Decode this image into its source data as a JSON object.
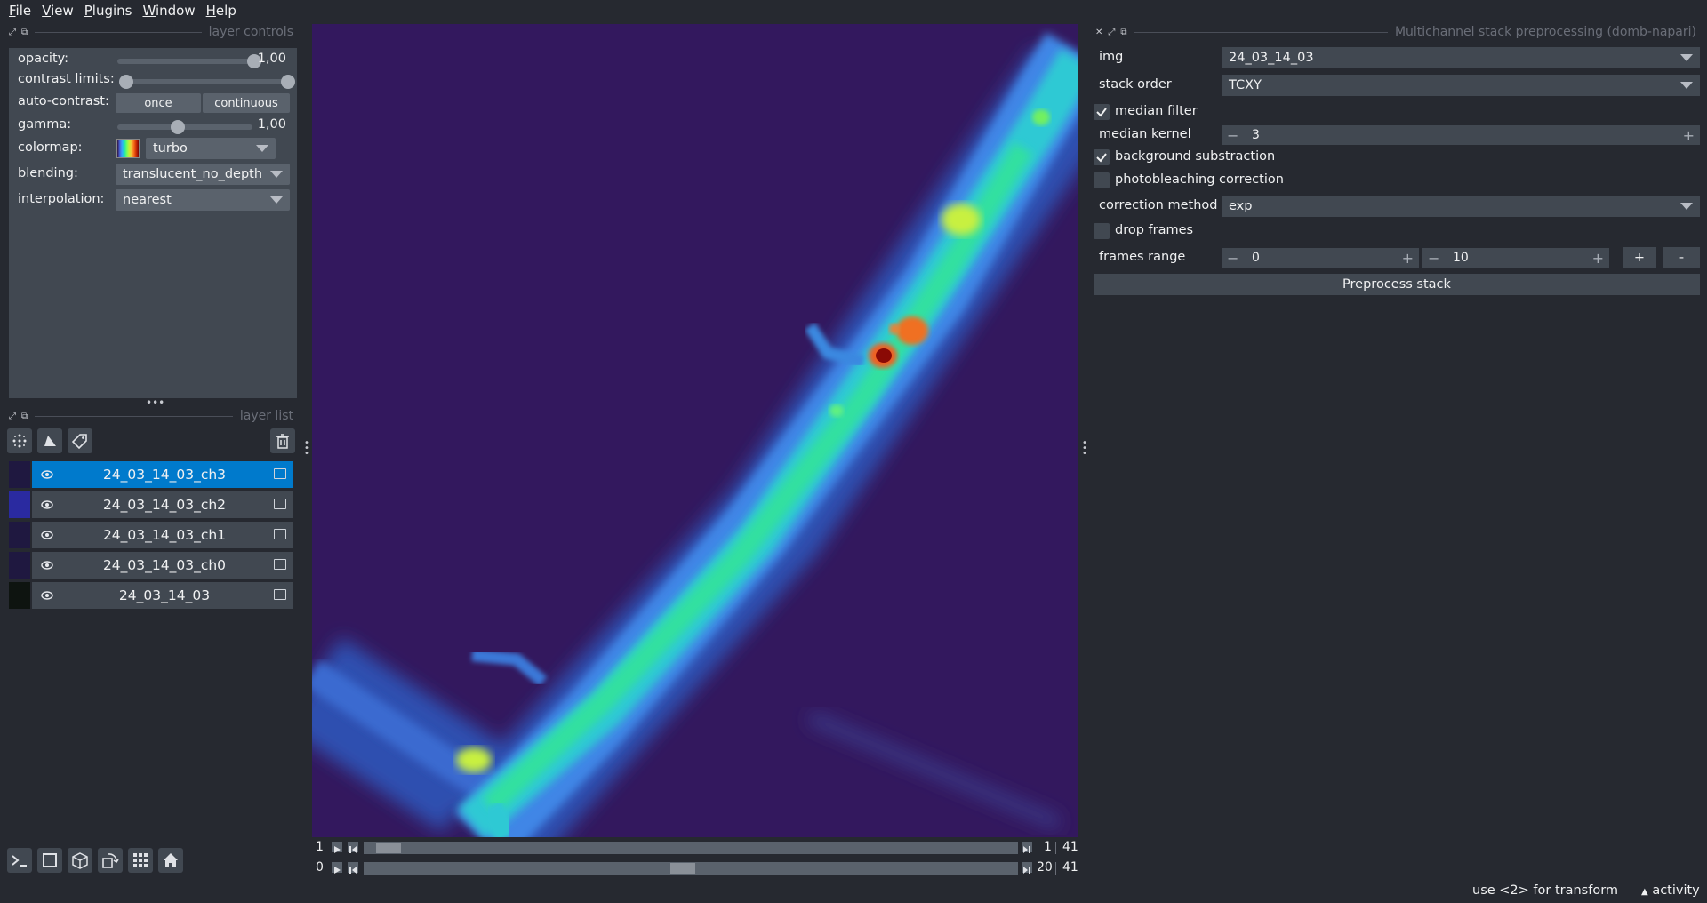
{
  "menubar": {
    "items": [
      {
        "first": "F",
        "rest": "ile"
      },
      {
        "first": "V",
        "rest": "iew"
      },
      {
        "first": "P",
        "rest": "lugins"
      },
      {
        "first": "W",
        "rest": "indow"
      },
      {
        "first": "H",
        "rest": "elp"
      }
    ]
  },
  "layer_controls": {
    "title": "layer controls",
    "opacity_label": "opacity:",
    "opacity_value": "1,00",
    "opacity_level": 1.0,
    "contrast_label": "contrast limits:",
    "auto_contrast_label": "auto-contrast:",
    "auto_once": "once",
    "auto_continuous": "continuous",
    "gamma_label": "gamma:",
    "gamma_value": "1,00",
    "colormap_label": "colormap:",
    "colormap_value": "turbo",
    "blending_label": "blending:",
    "blending_value": "translucent_no_depth",
    "interpolation_label": "interpolation:",
    "interpolation_value": "nearest"
  },
  "layer_list": {
    "title": "layer list",
    "layers": [
      {
        "name": "24_03_14_03_ch3",
        "selected": true
      },
      {
        "name": "24_03_14_03_ch2",
        "selected": false
      },
      {
        "name": "24_03_14_03_ch1",
        "selected": false
      },
      {
        "name": "24_03_14_03_ch0",
        "selected": false
      },
      {
        "name": "24_03_14_03",
        "selected": false
      }
    ]
  },
  "dims": {
    "row1": {
      "axis": "1",
      "current": "1",
      "total": "41"
    },
    "row2": {
      "axis": "0",
      "current": "20",
      "total": "41"
    }
  },
  "plugin": {
    "title": "Multichannel stack preprocessing (domb-napari)",
    "img_label": "img",
    "img_value": "24_03_14_03",
    "stack_order_label": "stack order",
    "stack_order_value": "TCXY",
    "median_filter_label": "median filter",
    "median_kernel_label": "median kernel",
    "median_kernel_value": "3",
    "background_label": "background substraction",
    "photobleaching_label": "photobleaching correction",
    "correction_method_label": "correction method",
    "correction_method_value": "exp",
    "drop_frames_label": "drop frames",
    "frames_range_label": "frames range",
    "frames_start": "0",
    "frames_end": "10",
    "plus_label": "+",
    "minus_label": "-",
    "preprocess_label": "Preprocess stack"
  },
  "status": {
    "hint": "use <2> for transform",
    "activity": "activity"
  }
}
